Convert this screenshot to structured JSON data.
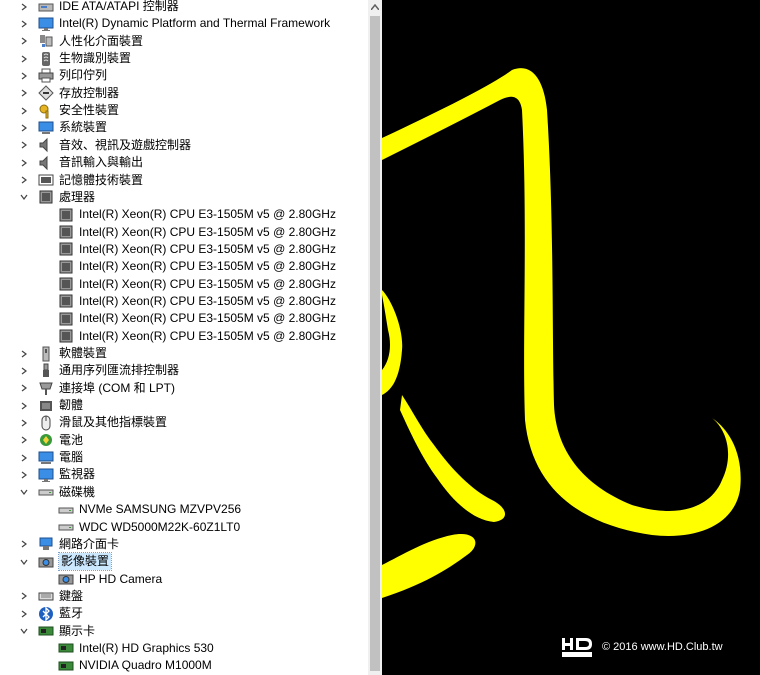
{
  "tree": {
    "rows": [
      {
        "label": "IDE ATA/ATAPI 控制器",
        "indent": 0,
        "expander": "collapsed",
        "icon": "ide-icon"
      },
      {
        "label": "Intel(R) Dynamic Platform and Thermal Framework",
        "indent": 0,
        "expander": "collapsed",
        "icon": "monitor-icon"
      },
      {
        "label": "人性化介面裝置",
        "indent": 0,
        "expander": "collapsed",
        "icon": "hid-icon"
      },
      {
        "label": "生物識別裝置",
        "indent": 0,
        "expander": "collapsed",
        "icon": "biometric-icon"
      },
      {
        "label": "列印佇列",
        "indent": 0,
        "expander": "collapsed",
        "icon": "printer-icon"
      },
      {
        "label": "存放控制器",
        "indent": 0,
        "expander": "collapsed",
        "icon": "storage-controller-icon"
      },
      {
        "label": "安全性裝置",
        "indent": 0,
        "expander": "collapsed",
        "icon": "security-key-icon"
      },
      {
        "label": "系統裝置",
        "indent": 0,
        "expander": "collapsed",
        "icon": "system-device-icon"
      },
      {
        "label": "音效、視訊及遊戲控制器",
        "indent": 0,
        "expander": "collapsed",
        "icon": "speaker-icon"
      },
      {
        "label": "音訊輸入與輸出",
        "indent": 0,
        "expander": "collapsed",
        "icon": "speaker-icon"
      },
      {
        "label": "記憶體技術裝置",
        "indent": 0,
        "expander": "collapsed",
        "icon": "memory-icon"
      },
      {
        "label": "處理器",
        "indent": 0,
        "expander": "expanded",
        "icon": "processor-icon"
      },
      {
        "label": "Intel(R) Xeon(R) CPU E3-1505M v5 @ 2.80GHz",
        "indent": 1,
        "expander": "none",
        "icon": "processor-icon"
      },
      {
        "label": "Intel(R) Xeon(R) CPU E3-1505M v5 @ 2.80GHz",
        "indent": 1,
        "expander": "none",
        "icon": "processor-icon"
      },
      {
        "label": "Intel(R) Xeon(R) CPU E3-1505M v5 @ 2.80GHz",
        "indent": 1,
        "expander": "none",
        "icon": "processor-icon"
      },
      {
        "label": "Intel(R) Xeon(R) CPU E3-1505M v5 @ 2.80GHz",
        "indent": 1,
        "expander": "none",
        "icon": "processor-icon"
      },
      {
        "label": "Intel(R) Xeon(R) CPU E3-1505M v5 @ 2.80GHz",
        "indent": 1,
        "expander": "none",
        "icon": "processor-icon"
      },
      {
        "label": "Intel(R) Xeon(R) CPU E3-1505M v5 @ 2.80GHz",
        "indent": 1,
        "expander": "none",
        "icon": "processor-icon"
      },
      {
        "label": "Intel(R) Xeon(R) CPU E3-1505M v5 @ 2.80GHz",
        "indent": 1,
        "expander": "none",
        "icon": "processor-icon"
      },
      {
        "label": "Intel(R) Xeon(R) CPU E3-1505M v5 @ 2.80GHz",
        "indent": 1,
        "expander": "none",
        "icon": "processor-icon"
      },
      {
        "label": "軟體裝置",
        "indent": 0,
        "expander": "collapsed",
        "icon": "software-device-icon"
      },
      {
        "label": "通用序列匯流排控制器",
        "indent": 0,
        "expander": "collapsed",
        "icon": "usb-icon"
      },
      {
        "label": "連接埠 (COM 和 LPT)",
        "indent": 0,
        "expander": "collapsed",
        "icon": "port-icon"
      },
      {
        "label": "韌體",
        "indent": 0,
        "expander": "collapsed",
        "icon": "firmware-icon"
      },
      {
        "label": "滑鼠及其他指標裝置",
        "indent": 0,
        "expander": "collapsed",
        "icon": "mouse-icon"
      },
      {
        "label": "電池",
        "indent": 0,
        "expander": "collapsed",
        "icon": "battery-icon"
      },
      {
        "label": "電腦",
        "indent": 0,
        "expander": "collapsed",
        "icon": "computer-icon"
      },
      {
        "label": "監視器",
        "indent": 0,
        "expander": "collapsed",
        "icon": "monitor-icon"
      },
      {
        "label": "磁碟機",
        "indent": 0,
        "expander": "expanded",
        "icon": "disk-drive-icon"
      },
      {
        "label": "NVMe SAMSUNG MZVPV256",
        "indent": 1,
        "expander": "none",
        "icon": "disk-drive-icon"
      },
      {
        "label": "WDC WD5000M22K-60Z1LT0",
        "indent": 1,
        "expander": "none",
        "icon": "disk-drive-icon"
      },
      {
        "label": "網路介面卡",
        "indent": 0,
        "expander": "collapsed",
        "icon": "network-adapter-icon"
      },
      {
        "label": "影像裝置",
        "indent": 0,
        "expander": "expanded",
        "icon": "camera-icon",
        "selected": true
      },
      {
        "label": "HP HD Camera",
        "indent": 1,
        "expander": "none",
        "icon": "camera-icon"
      },
      {
        "label": "鍵盤",
        "indent": 0,
        "expander": "collapsed",
        "icon": "keyboard-icon"
      },
      {
        "label": "藍牙",
        "indent": 0,
        "expander": "collapsed",
        "icon": "bluetooth-icon"
      },
      {
        "label": "顯示卡",
        "indent": 0,
        "expander": "expanded",
        "icon": "display-adapter-icon"
      },
      {
        "label": "Intel(R) HD Graphics 530",
        "indent": 1,
        "expander": "none",
        "icon": "display-adapter-icon"
      },
      {
        "label": "NVIDIA Quadro M1000M",
        "indent": 1,
        "expander": "none",
        "icon": "display-adapter-icon"
      }
    ]
  },
  "watermark": {
    "logo_text": "HD CLUB",
    "text": "© 2016  www.HD.Club.tw"
  },
  "colors": {
    "selection": "#cce8ff",
    "artwork_background": "#000000",
    "calligraphy": "#ffff00"
  }
}
